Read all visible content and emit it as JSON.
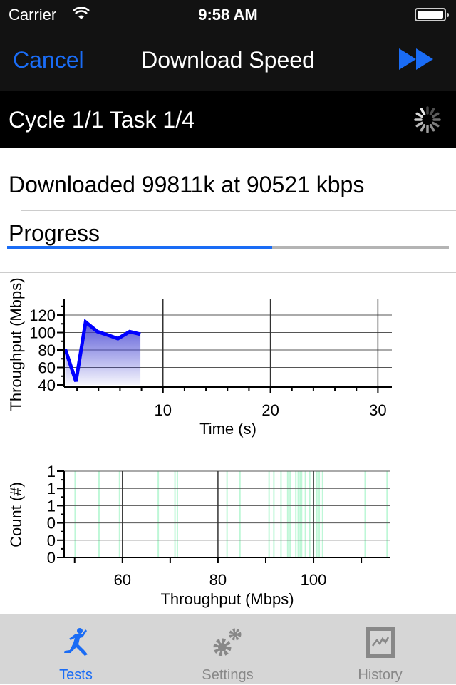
{
  "status_bar": {
    "carrier": "Carrier",
    "time": "9:58 AM",
    "battery_level": 1.0
  },
  "nav": {
    "cancel_label": "Cancel",
    "title": "Download Speed",
    "fast_forward_icon": "fast-forward-icon"
  },
  "cycle_band": {
    "text": "Cycle 1/1 Task 1/4",
    "spinner_icon": "activity-spinner-icon"
  },
  "download_status": "Downloaded 99811k at 90521 kbps",
  "progress": {
    "label": "Progress",
    "value_percent": 60
  },
  "colors": {
    "accent": "#1a6cf5",
    "line": "#0000ff",
    "histogram": "#7ff0b0"
  },
  "chart_data": [
    {
      "type": "area",
      "xlabel": "Time (s)",
      "ylabel": "Throughput (Mbps)",
      "xlim": [
        0.8,
        31.3
      ],
      "ylim": [
        40,
        138
      ],
      "xticks": [
        10,
        20,
        30
      ],
      "yticks": [
        40,
        60,
        80,
        100,
        120
      ],
      "grid": true,
      "x": [
        0.9,
        1.9,
        2.8,
        3.9,
        4.9,
        5.8,
        6.9,
        7.9
      ],
      "y": [
        81,
        44,
        112,
        101,
        97,
        93,
        101,
        98
      ]
    },
    {
      "type": "histogram",
      "xlabel": "Throughput (Mbps)",
      "ylabel": "Count (#)",
      "xlim": [
        47.8,
        116.1
      ],
      "xticks": [
        60,
        80,
        100
      ],
      "ytick_labels": [
        "0",
        "0",
        "0",
        "1",
        "1",
        "1"
      ],
      "grid": true,
      "samples": [
        50.1,
        55.1,
        59.4,
        67.5,
        71,
        71.5,
        81.9,
        84.6,
        90.7,
        91.7,
        93.2,
        94.6,
        95.1,
        96.3,
        96.8,
        97.2,
        97.5,
        98.3,
        99.2,
        100,
        100.7,
        101.2,
        101.9,
        110.8,
        115.4
      ]
    }
  ],
  "tabs": [
    {
      "label": "Tests",
      "icon": "running-man-icon",
      "active": true
    },
    {
      "label": "Settings",
      "icon": "gears-icon",
      "active": false
    },
    {
      "label": "History",
      "icon": "chart-history-icon",
      "active": false
    }
  ]
}
